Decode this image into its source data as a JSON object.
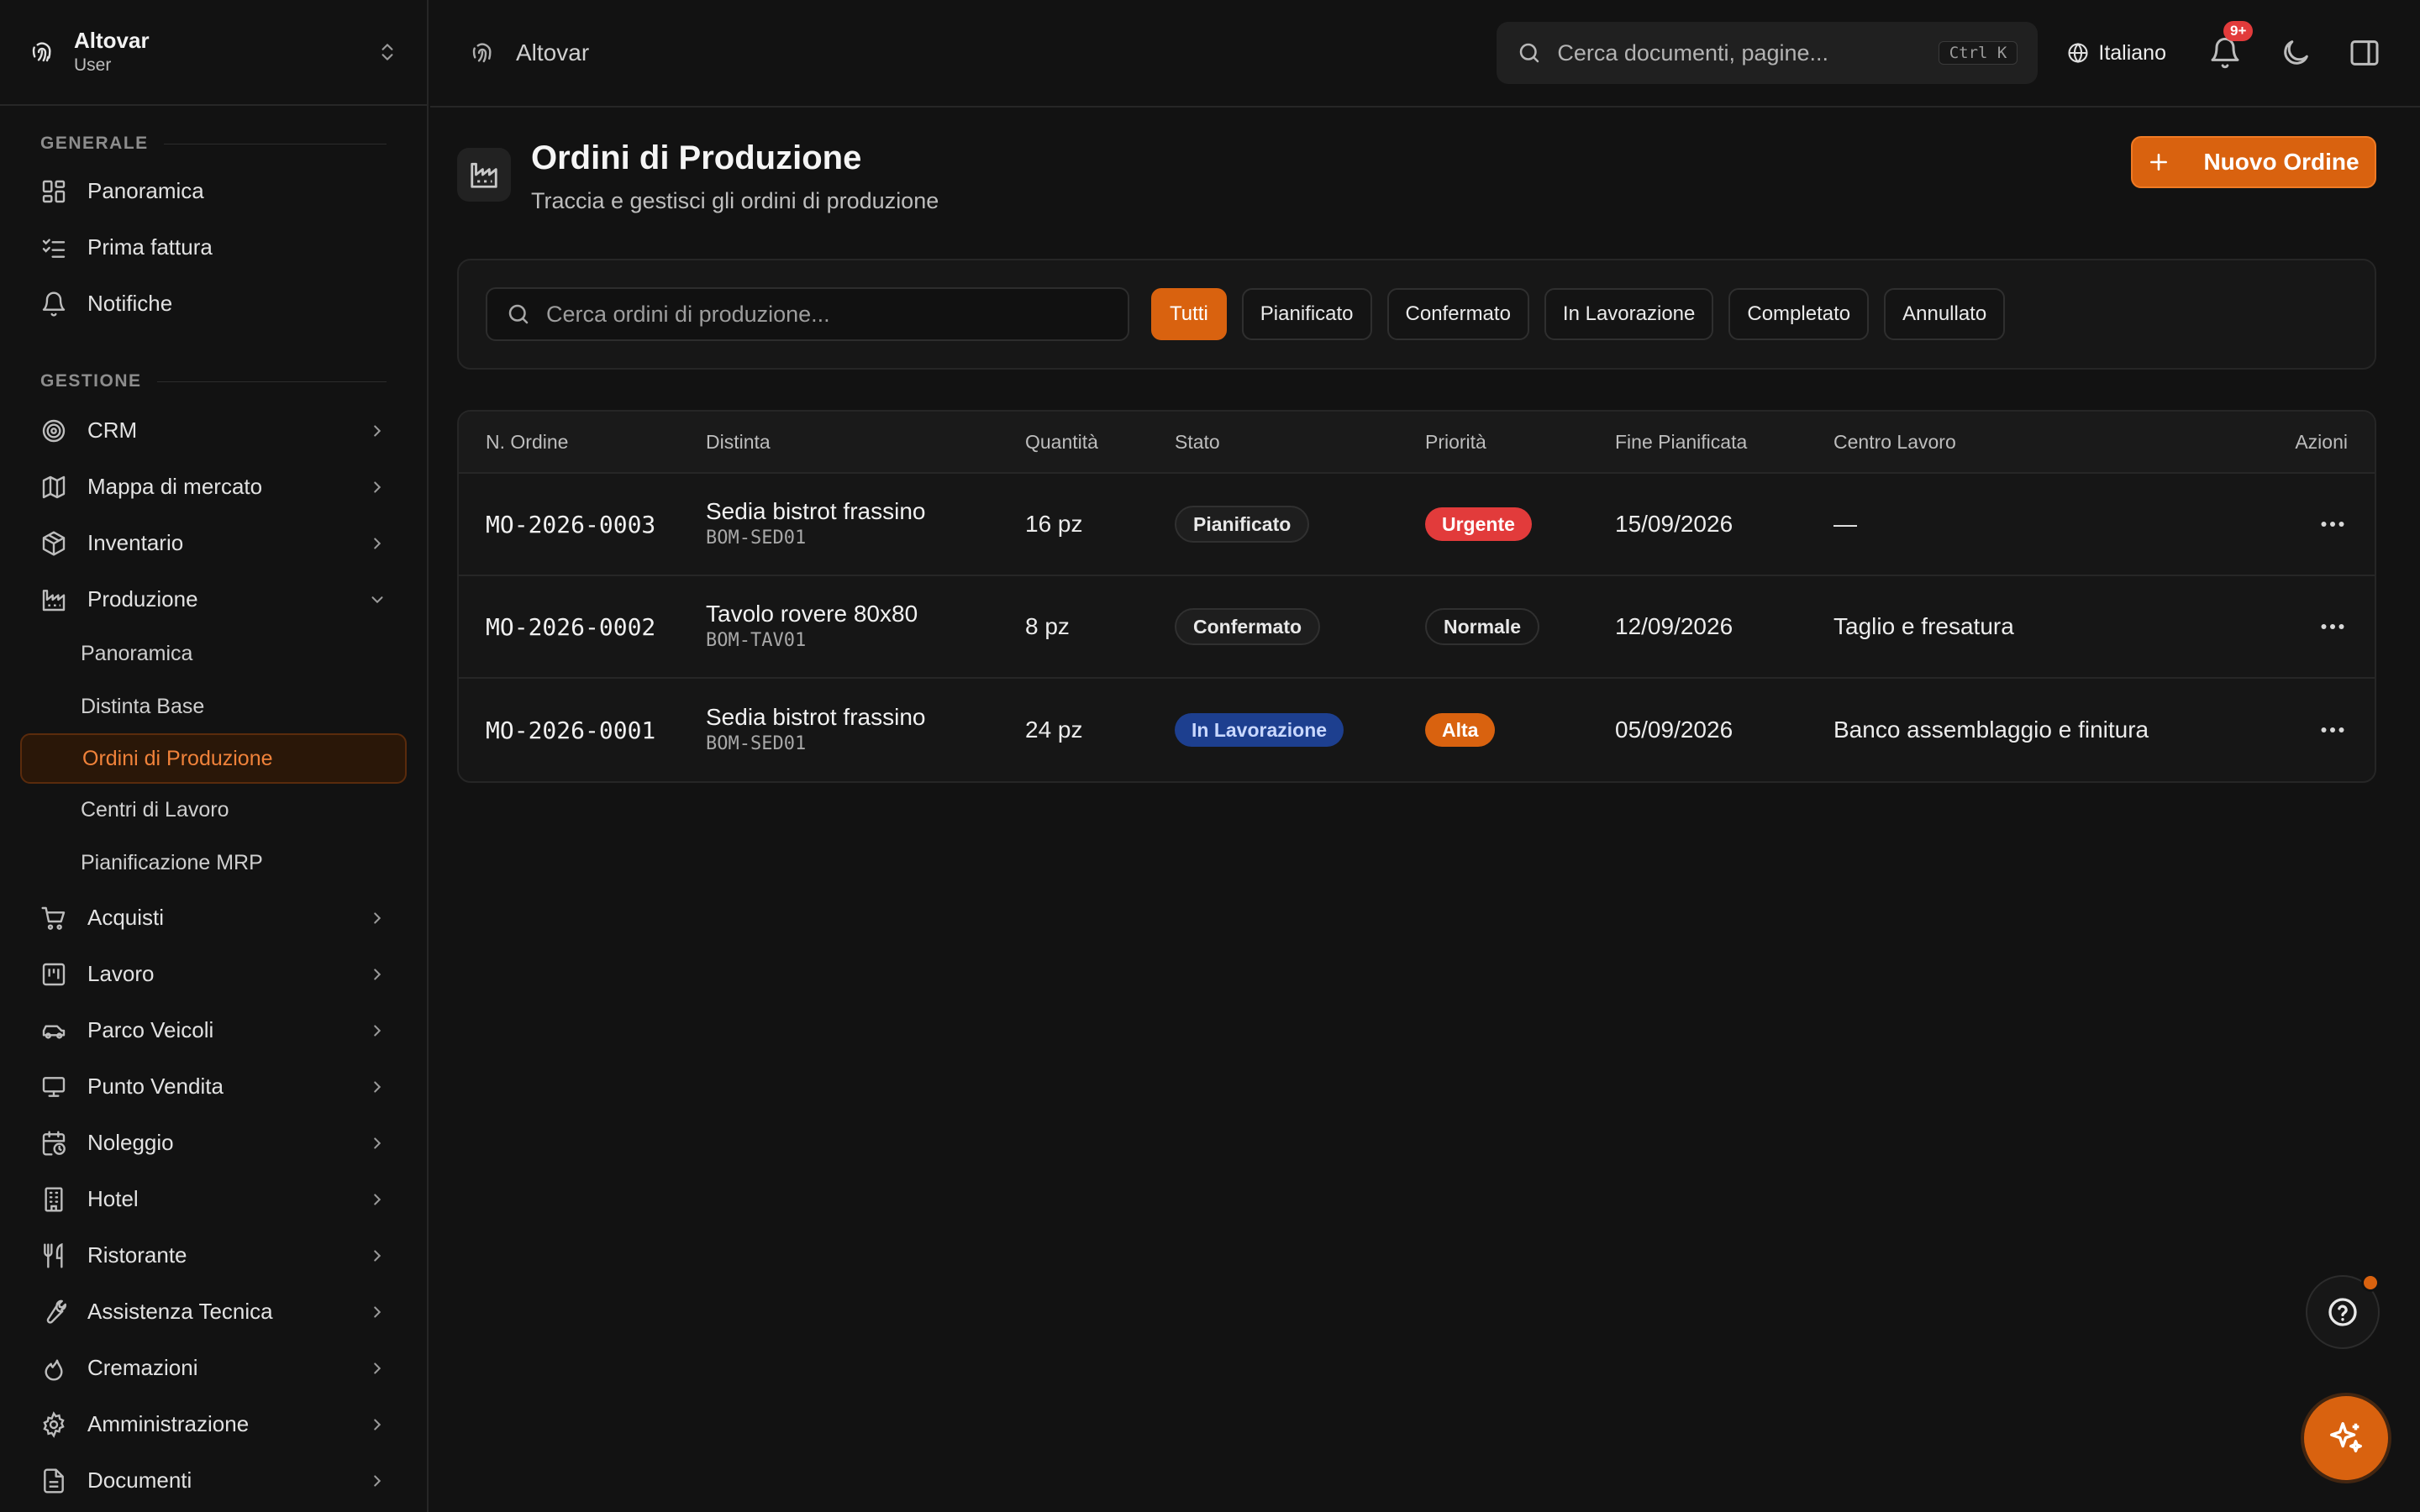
{
  "brand": {
    "app_name": "Altovar",
    "role": "User"
  },
  "sidebar": {
    "sections": [
      {
        "label": "GENERALE",
        "items": [
          {
            "label": "Panoramica",
            "icon": "dashboard-icon"
          },
          {
            "label": "Prima fattura",
            "icon": "checklist-icon"
          },
          {
            "label": "Notifiche",
            "icon": "bell-icon"
          }
        ]
      },
      {
        "label": "GESTIONE",
        "items": [
          {
            "label": "CRM",
            "icon": "target-icon"
          },
          {
            "label": "Mappa di mercato",
            "icon": "map-icon"
          },
          {
            "label": "Inventario",
            "icon": "package-icon"
          },
          {
            "label": "Produzione",
            "icon": "factory-icon",
            "expanded": true,
            "children": [
              {
                "label": "Panoramica"
              },
              {
                "label": "Distinta Base"
              },
              {
                "label": "Ordini di Produzione",
                "active": true
              },
              {
                "label": "Centri di Lavoro"
              },
              {
                "label": "Pianificazione MRP"
              }
            ]
          },
          {
            "label": "Acquisti",
            "icon": "cart-icon"
          },
          {
            "label": "Lavoro",
            "icon": "kanban-icon"
          },
          {
            "label": "Parco Veicoli",
            "icon": "car-icon"
          },
          {
            "label": "Punto Vendita",
            "icon": "monitor-icon"
          },
          {
            "label": "Noleggio",
            "icon": "calendar-clock-icon"
          },
          {
            "label": "Hotel",
            "icon": "building-icon"
          },
          {
            "label": "Ristorante",
            "icon": "utensils-icon"
          },
          {
            "label": "Assistenza Tecnica",
            "icon": "wrench-icon"
          },
          {
            "label": "Cremazioni",
            "icon": "flame-icon"
          },
          {
            "label": "Amministrazione",
            "icon": "settings-icon"
          },
          {
            "label": "Documenti",
            "icon": "document-icon"
          }
        ]
      }
    ]
  },
  "topbar": {
    "breadcrumb": "Altovar",
    "search_placeholder": "Cerca documenti, pagine...",
    "search_shortcut": "Ctrl K",
    "language": "Italiano",
    "notifications_badge": "9+"
  },
  "page": {
    "title": "Ordini di Produzione",
    "subtitle": "Traccia e gestisci gli ordini di produzione",
    "new_button": "Nuovo Ordine"
  },
  "filters": {
    "search_placeholder": "Cerca ordini di produzione...",
    "chips": [
      {
        "label": "Tutti",
        "active": true
      },
      {
        "label": "Pianificato"
      },
      {
        "label": "Confermato"
      },
      {
        "label": "In Lavorazione"
      },
      {
        "label": "Completato"
      },
      {
        "label": "Annullato"
      }
    ]
  },
  "table": {
    "columns": [
      "N. Ordine",
      "Distinta",
      "Quantità",
      "Stato",
      "Priorità",
      "Fine Pianificata",
      "Centro Lavoro",
      "Azioni"
    ],
    "rows": [
      {
        "order": "MO-2026-0003",
        "bom_name": "Sedia bistrot frassino",
        "bom_code": "BOM-SED01",
        "qty": "16 pz",
        "status": "Pianificato",
        "status_style": "plain",
        "priority": "Urgente",
        "priority_style": "red",
        "end": "15/09/2026",
        "center": "—"
      },
      {
        "order": "MO-2026-0002",
        "bom_name": "Tavolo rovere 80x80",
        "bom_code": "BOM-TAV01",
        "qty": "8 pz",
        "status": "Confermato",
        "status_style": "plain",
        "priority": "Normale",
        "priority_style": "plain",
        "end": "12/09/2026",
        "center": "Taglio e fresatura"
      },
      {
        "order": "MO-2026-0001",
        "bom_name": "Sedia bistrot frassino",
        "bom_code": "BOM-SED01",
        "qty": "24 pz",
        "status": "In Lavorazione",
        "status_style": "blue",
        "priority": "Alta",
        "priority_style": "orange",
        "end": "05/09/2026",
        "center": "Banco assemblaggio e finitura"
      }
    ]
  },
  "colors": {
    "accent": "#d9620f",
    "danger": "#e23b3b",
    "info": "#1d3f8f",
    "background": "#121212"
  }
}
